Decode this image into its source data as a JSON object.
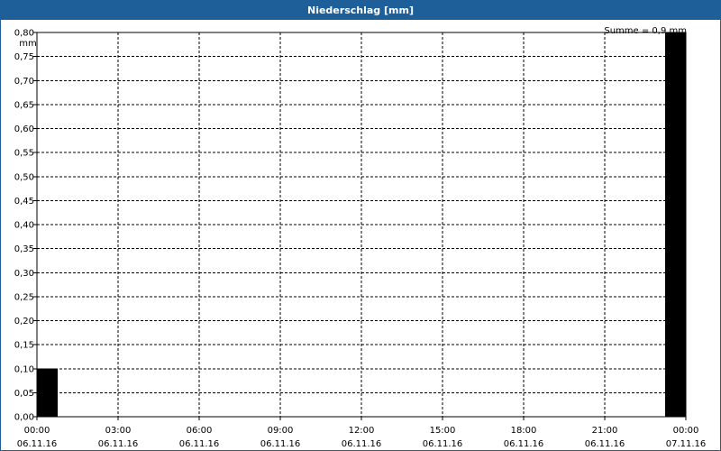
{
  "colors": {
    "titlebar": "#1f5f99",
    "bar": "#000000",
    "grid": "#000000",
    "background": "#ffffff"
  },
  "chart_data": {
    "type": "bar",
    "title": "Niederschlag [mm]",
    "unit_label": "mm",
    "sum_label": "Summe = 0,9 mm",
    "ylim": [
      0,
      0.8
    ],
    "y_ticks": [
      "0,00",
      "0,05",
      "0,10",
      "0,15",
      "0,20",
      "0,25",
      "0,30",
      "0,35",
      "0,40",
      "0,45",
      "0,50",
      "0,55",
      "0,60",
      "0,65",
      "0,70",
      "0,75",
      "0,80"
    ],
    "xlim_hours": [
      0,
      24
    ],
    "x_ticks": [
      {
        "time": "00:00",
        "date": "06.11.16"
      },
      {
        "time": "03:00",
        "date": "06.11.16"
      },
      {
        "time": "06:00",
        "date": "06.11.16"
      },
      {
        "time": "09:00",
        "date": "06.11.16"
      },
      {
        "time": "12:00",
        "date": "06.11.16"
      },
      {
        "time": "15:00",
        "date": "06.11.16"
      },
      {
        "time": "18:00",
        "date": "06.11.16"
      },
      {
        "time": "21:00",
        "date": "06.11.16"
      },
      {
        "time": "00:00",
        "date": "07.11.16"
      }
    ],
    "bars": [
      {
        "start": "06.11.16 00:00",
        "end": "06.11.16 00:45",
        "value": 0.1
      },
      {
        "start": "06.11.16 23:15",
        "end": "07.11.16 00:00",
        "value": 0.8
      }
    ],
    "grid": true
  }
}
